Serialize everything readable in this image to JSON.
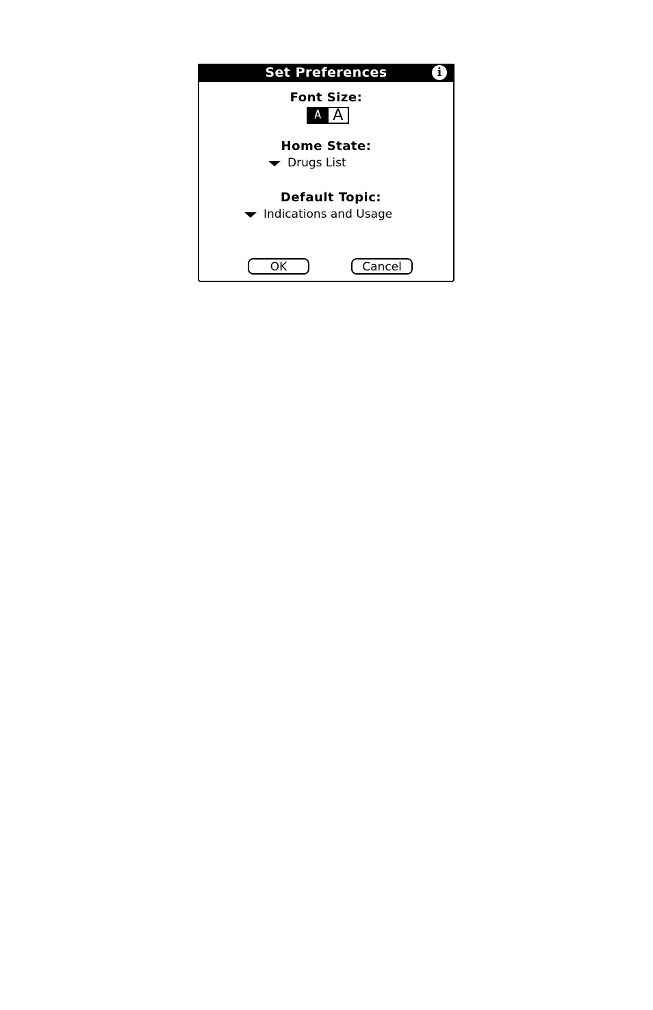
{
  "dialog": {
    "title": "Set Preferences",
    "info_icon": "info-icon",
    "info_glyph": "i"
  },
  "font_size": {
    "label": "Font Size:",
    "options": [
      {
        "label": "A",
        "selected": true
      },
      {
        "label": "A",
        "selected": false
      }
    ]
  },
  "home_state": {
    "label": "Home State:",
    "value": "Drugs List"
  },
  "default_topic": {
    "label": "Default Topic:",
    "value": "Indications and Usage"
  },
  "buttons": {
    "ok_label": "OK",
    "cancel_label": "Cancel"
  }
}
